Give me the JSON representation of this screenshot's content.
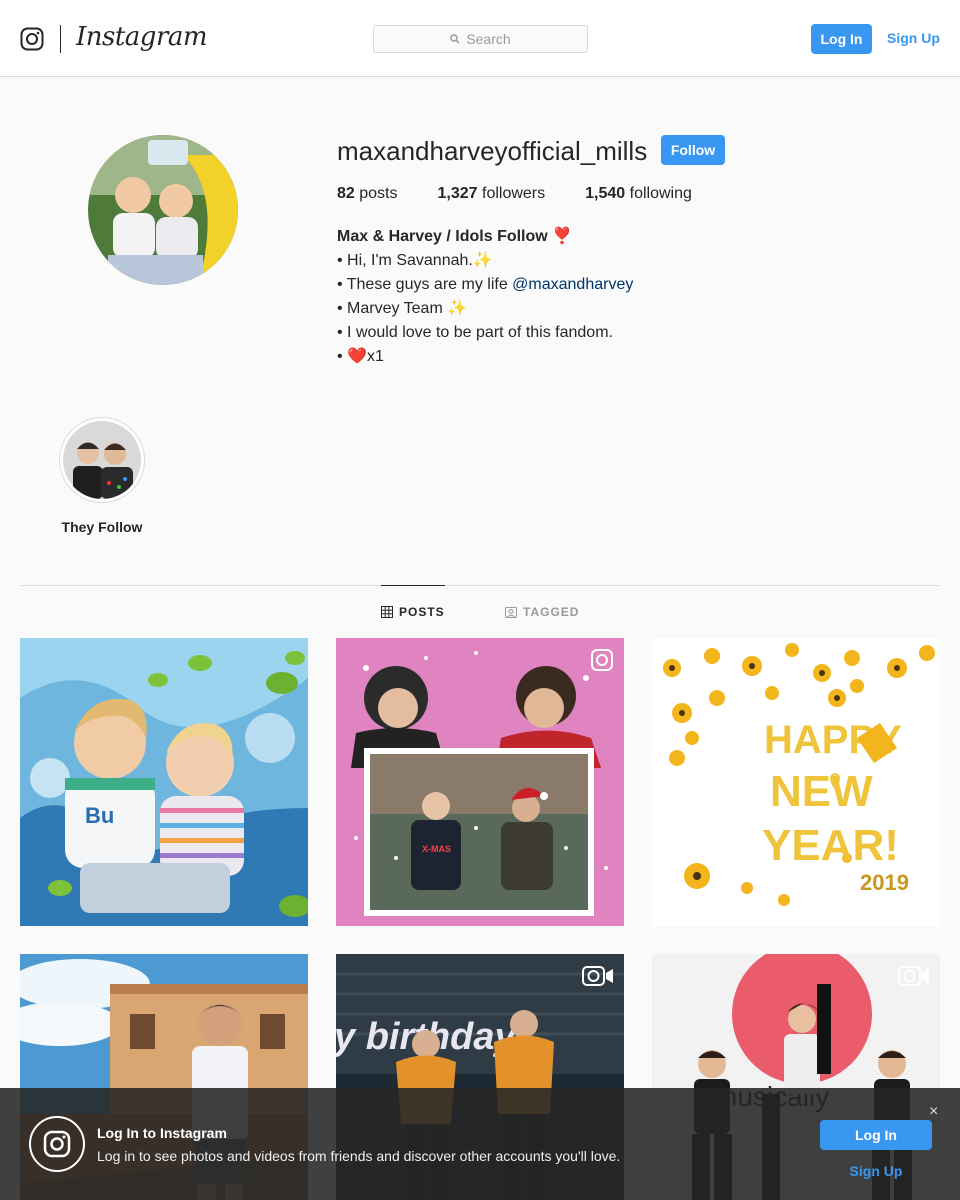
{
  "header": {
    "brand": "Instagram",
    "search_placeholder": "Search",
    "login_label": "Log In",
    "signup_label": "Sign Up"
  },
  "profile": {
    "username": "maxandharveyofficial_mills",
    "follow_label": "Follow",
    "stats": [
      {
        "value": "82",
        "label": "posts"
      },
      {
        "value": "1,327",
        "label": "followers"
      },
      {
        "value": "1,540",
        "label": "following"
      }
    ],
    "bio_name": "Max & Harvey / Idols Follow ❣️",
    "bio_lines": [
      "• Hi, I'm Savannah.✨",
      "• These guys are my life ",
      "• Marvey Team ✨",
      "• I would love to be part of this fandom.",
      "• ❤️x1"
    ],
    "bio_mention": "@maxandharvey"
  },
  "highlights": [
    {
      "label": "They Follow"
    }
  ],
  "tabs": [
    {
      "label": "POSTS",
      "icon": "grid-icon",
      "active": true
    },
    {
      "label": "TAGGED",
      "icon": "tag-icon",
      "active": false
    }
  ],
  "posts": [
    {
      "kind": "photo",
      "badge": ""
    },
    {
      "kind": "carousel",
      "badge": "igtv-icon"
    },
    {
      "kind": "photo",
      "badge": ""
    },
    {
      "kind": "photo",
      "badge": ""
    },
    {
      "kind": "video",
      "badge": "video-icon"
    },
    {
      "kind": "video",
      "badge": "video-icon"
    }
  ],
  "post_texts": {
    "new_year_happy": "HAPPY",
    "new_year_new": "NEW",
    "new_year_year": "YEAR!",
    "new_year_year_num": "2019",
    "birthday": "y birthday",
    "musically": "musically"
  },
  "login_banner": {
    "title": "Log In to Instagram",
    "text": "Log in to see photos and videos from friends and discover other accounts you'll love.",
    "login_label": "Log In",
    "signup_label": "Sign Up",
    "close": "×"
  },
  "colors": {
    "accent": "#3897f0",
    "text": "#262626",
    "muted": "#999999",
    "border": "#dbdbdb"
  }
}
